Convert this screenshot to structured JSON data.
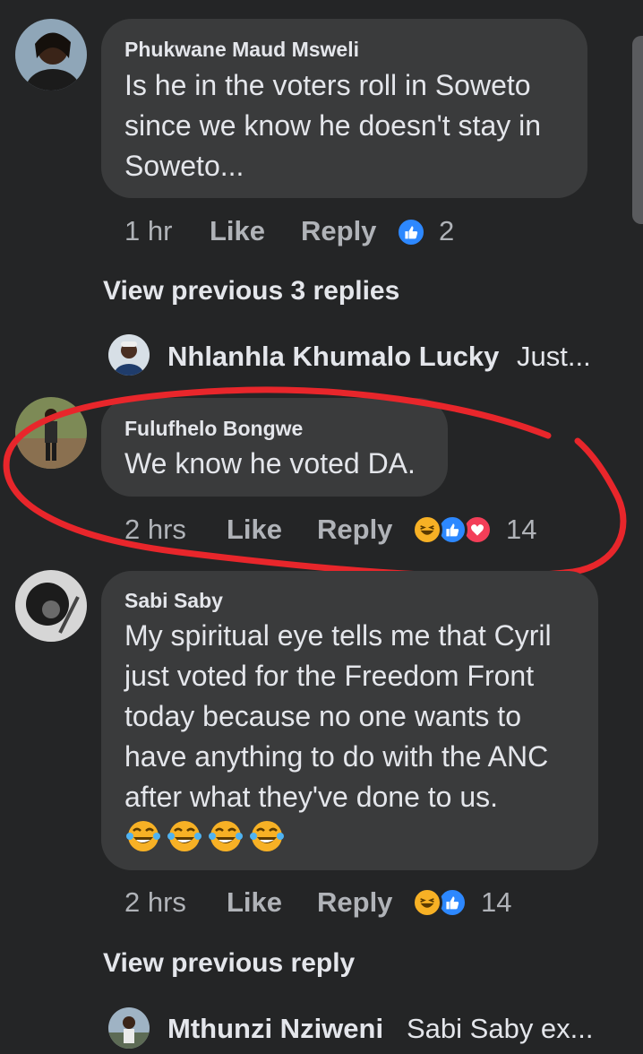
{
  "comments": [
    {
      "author": "Phukwane Maud Msweli",
      "text": "Is he in the voters roll in Soweto\nsince we know he doesn't stay in\nSoweto...",
      "time": "1 hr",
      "like_label": "Like",
      "reply_label": "Reply",
      "reaction_icons": [
        "like-icon"
      ],
      "reaction_count": "2"
    },
    {
      "author": "Fulufhelo Bongwe",
      "text": "We know he voted DA.",
      "time": "2 hrs",
      "like_label": "Like",
      "reply_label": "Reply",
      "reaction_icons": [
        "haha-icon",
        "like-icon",
        "love-icon"
      ],
      "reaction_count": "14"
    },
    {
      "author": "Sabi Saby",
      "text": "My spiritual eye tells me that Cyril\njust voted for the Freedom Front\ntoday because no one wants to\nhave anything to do with the ANC\nafter what they've done to us.",
      "emojis": [
        "tears-of-joy-emoji",
        "tears-of-joy-emoji",
        "tears-of-joy-emoji",
        "tears-of-joy-emoji"
      ],
      "time": "2 hrs",
      "like_label": "Like",
      "reply_label": "Reply",
      "reaction_icons": [
        "haha-icon",
        "like-icon"
      ],
      "reaction_count": "14"
    }
  ],
  "view_previous_1": "View previous 3 replies",
  "view_previous_2": "View previous reply",
  "reply_previews": [
    {
      "author": "Nhlanhla Khumalo Lucky",
      "snippet": "Just..."
    },
    {
      "author": "Mthunzi Nziweni",
      "snippet": "Sabi Saby ex..."
    }
  ],
  "annotation": {
    "type": "hand-drawn-circle",
    "color": "#e8262b"
  },
  "colors": {
    "background": "#242526",
    "bubble": "#3a3b3c",
    "text": "#e4e6eb",
    "secondary_text": "#b0b3b8",
    "like_blue": "#2d88ff",
    "haha_yellow": "#f7b125",
    "love_red": "#f33e58"
  }
}
